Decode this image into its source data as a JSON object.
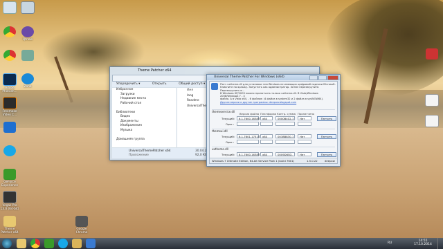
{
  "desktop": {
    "icons": [
      {
        "label": "",
        "icon": "computer-icon"
      },
      {
        "label": "",
        "icon": "recycle-bin-icon"
      },
      {
        "label": "",
        "icon": "chrome-icon"
      },
      {
        "label": "Qtnew",
        "icon": "app-icon"
      },
      {
        "label": "",
        "icon": "chrome-icon"
      },
      {
        "label": "",
        "icon": "app-icon"
      },
      {
        "label": "Adobe Photosh...",
        "icon": "photoshop-icon"
      },
      {
        "label": "Zona",
        "icon": "zona-icon"
      },
      {
        "label": "Freemake Video C...",
        "icon": "freemake-icon"
      },
      {
        "label": "",
        "icon": "app-icon"
      },
      {
        "label": "",
        "icon": "skype-icon"
      },
      {
        "label": "GeForce Experience",
        "icon": "geforce-icon"
      },
      {
        "label": "Vegas Pro 13.0 (64-bit)",
        "icon": "vegas-icon"
      },
      {
        "label": "Theme Patcher x64",
        "icon": "folder-icon"
      },
      {
        "label": "Google Chrome",
        "icon": "chrome-icon"
      },
      {
        "label": "",
        "icon": "app-icon"
      },
      {
        "label": "",
        "icon": "document-icon"
      },
      {
        "label": "",
        "icon": "document-icon"
      }
    ]
  },
  "explorer": {
    "title": "Theme Patcher x64",
    "toolbar": [
      "Упорядочить ▾",
      "Открыть",
      "Общий доступ ▾",
      "Новая папка"
    ],
    "nav": [
      {
        "label": "Избранное",
        "header": true
      },
      {
        "label": "Загрузки",
        "header": false
      },
      {
        "label": "Недавние места",
        "header": false
      },
      {
        "label": "Рабочий стол",
        "header": false
      },
      {
        "label": "",
        "header": false
      },
      {
        "label": "Библиотеки",
        "header": true
      },
      {
        "label": "Видео",
        "header": false
      },
      {
        "label": "Документы",
        "header": false
      },
      {
        "label": "Изображения",
        "header": false
      },
      {
        "label": "Музыка",
        "header": false
      },
      {
        "label": "",
        "header": false
      },
      {
        "label": "Домашняя группа",
        "header": true
      }
    ],
    "column_header": "Имя",
    "files": [
      "lang",
      "Readme",
      "UniversalTheme"
    ],
    "status": {
      "name": "UniversalThemePatcher x64",
      "type": "Приложение",
      "date": "30.04.2009 22:...",
      "size": "92,0 КБ"
    }
  },
  "patcher": {
    "title": "Universal Theme Patcher For Windows  (x64)",
    "description": [
      "Патч uxtheme.dll для установки тем Windows не имеющих цифровой подписи Microsoft.",
      "Кликните по ярлыку. Запустить как администратор. Затем перезагрузите. Перезагрузить в...",
      "В Windows XP/2003 можно пропатчить только uxtheme.dll. В Vista/Windows 2008/Windows 7 - 3",
      "файла. А в Vista x64, - 6 файлов: (4 файла в system32 и 2 файла в sysWOW64)."
    ],
    "link": "Другие версии и другие программы: deepxw.blogspot.com",
    "headers": [
      "Версия файла",
      "Платформа",
      "Контр. сумма",
      "Пропатчено"
    ],
    "files": [
      {
        "name": "themeservice.dll",
        "version": "6.1.7600.16385",
        "platform": "x64",
        "checksum": "0000B402-1",
        "patched": "Нет",
        "action": "Патчить"
      },
      {
        "name": "themeui.dll",
        "version": "6.1.7601.17514",
        "platform": "x64",
        "checksum": "0038B830-1",
        "patched": "Нет",
        "action": "Патчить"
      },
      {
        "name": "uxtheme.dll",
        "version": "6.1.7600.16385",
        "platform": "x64",
        "checksum": "0009D65D-1",
        "patched": "Нет",
        "action": "Патчить"
      }
    ],
    "row_labels": {
      "current": "Текущий:",
      "orig": "Ориг.:"
    },
    "status_os": "Windows 7 Ultimate Edition, 64-bit Service Pack 1 (build 7601)",
    "status_version": "1.5.0.22",
    "status_author": "deepxw"
  },
  "taskbar": {
    "items": [
      "start-orb-icon",
      "explorer-icon",
      "chrome-icon",
      "nvidia-icon",
      "skype-icon",
      "folder-icon",
      "patcher-icon"
    ],
    "lang": "RU",
    "time": "14:55",
    "date": "17.10.2014"
  },
  "colors": {
    "accent": "#1a4fc2",
    "titlebar": "#b7cde4",
    "close": "#c74a3a"
  }
}
